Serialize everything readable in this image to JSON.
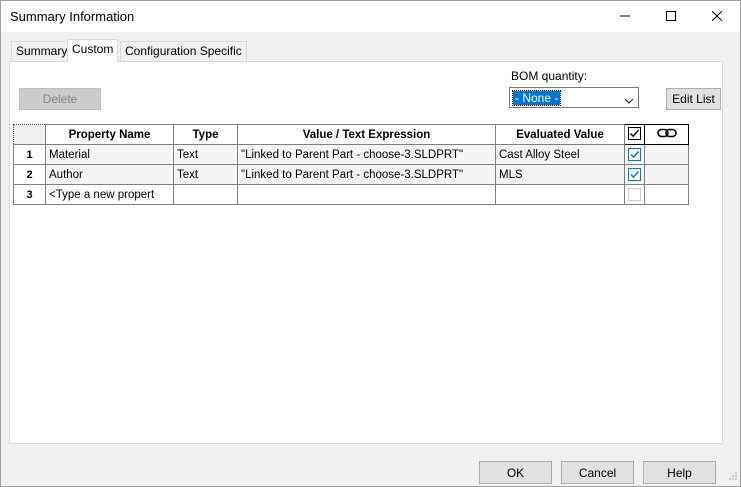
{
  "window": {
    "title": "Summary Information"
  },
  "tabs": [
    {
      "label": "Summary",
      "active": false
    },
    {
      "label": "Custom",
      "active": true
    },
    {
      "label": "Configuration Specific",
      "active": false
    }
  ],
  "toolbar": {
    "delete_label": "Delete",
    "bom_label": "BOM quantity:",
    "bom_selected": "- None -",
    "edit_list_label": "Edit List"
  },
  "grid": {
    "headers": {
      "property_name": "Property Name",
      "type": "Type",
      "value": "Value / Text Expression",
      "evaluated": "Evaluated Value"
    },
    "rows": [
      {
        "num": "1",
        "property_name": "Material",
        "type": "Text",
        "value": "\"Linked to Parent Part - choose-3.SLDPRT\"",
        "evaluated": "Cast Alloy Steel",
        "linked": true
      },
      {
        "num": "2",
        "property_name": "Author",
        "type": "Text",
        "value": "\"Linked to Parent Part - choose-3.SLDPRT\"",
        "evaluated": "MLS",
        "linked": true
      }
    ],
    "new_row": {
      "num": "3",
      "placeholder": "<Type a new propert"
    }
  },
  "footer": {
    "ok_label": "OK",
    "cancel_label": "Cancel",
    "help_label": "Help"
  },
  "colors": {
    "accent": "#0078d7",
    "panel": "#ffffff",
    "window": "#f0f0f0"
  }
}
